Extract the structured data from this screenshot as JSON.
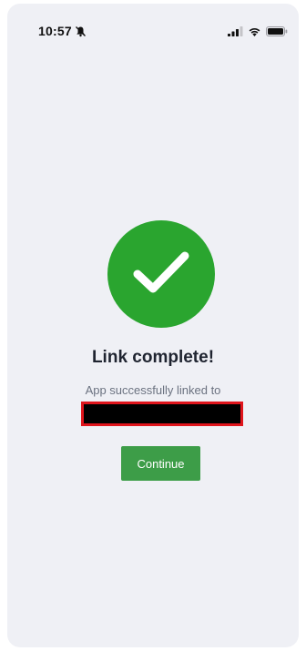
{
  "status_bar": {
    "time": "10:57",
    "icons": [
      "silent-bell-icon",
      "signal-icon",
      "wifi-icon",
      "battery-icon"
    ]
  },
  "link_result": {
    "icon": "checkmark-icon",
    "title": "Link complete!",
    "subtitle": "App successfully linked to",
    "continue_label": "Continue"
  },
  "colors": {
    "background": "#eff0f5",
    "success_green": "#2aa52f",
    "button_green": "#3d9d48",
    "redaction_border": "#e0151c"
  }
}
